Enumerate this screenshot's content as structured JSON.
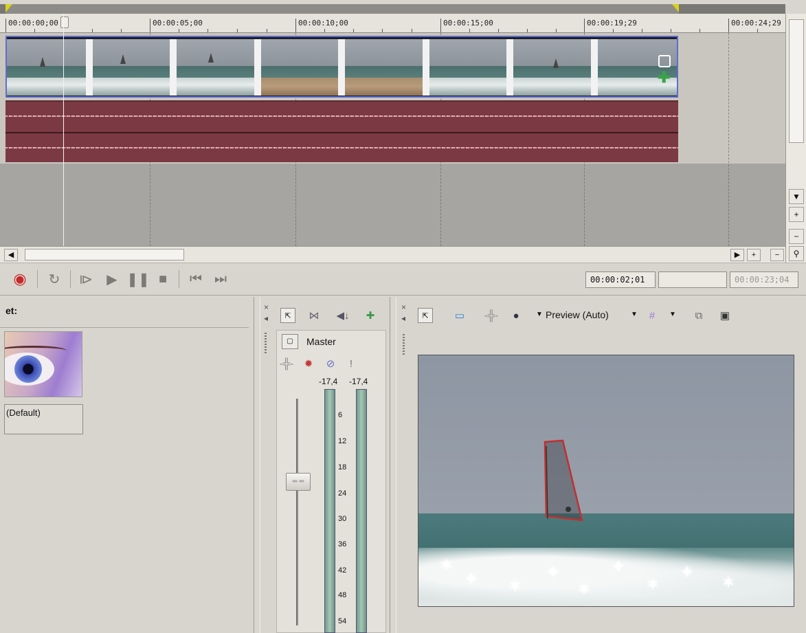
{
  "timeline": {
    "ruler_labels": [
      "00:00:00;00",
      "00:00:05;00",
      "00:00:10;00",
      "00:00:15;00",
      "00:00:19;29",
      "00:00:24;29"
    ]
  },
  "transport": {
    "record_icon": "record-icon",
    "loop_icon": "loop-icon",
    "play_from_start_icon": "play-from-start-icon",
    "play_icon": "play-icon",
    "pause_icon": "pause-icon",
    "stop_icon": "stop-icon",
    "prev_icon": "go-to-start-icon",
    "next_icon": "go-to-end-icon",
    "cursor_time": "00:00:02;01",
    "selection_time": "",
    "end_time": "00:00:23;04"
  },
  "left_panel": {
    "header": "et:",
    "preset_label": "(Default)"
  },
  "mixer": {
    "master_label": "Master",
    "peak_left": "-17,4",
    "peak_right": "-17,4",
    "scale": [
      "6",
      "12",
      "18",
      "24",
      "30",
      "36",
      "42",
      "48",
      "54"
    ]
  },
  "preview": {
    "mode_label": "Preview (Auto)"
  },
  "colors": {
    "audio_track": "#7b3a43",
    "video_selection": "#5f6bd0",
    "loop_flag": "#d7d21a"
  }
}
